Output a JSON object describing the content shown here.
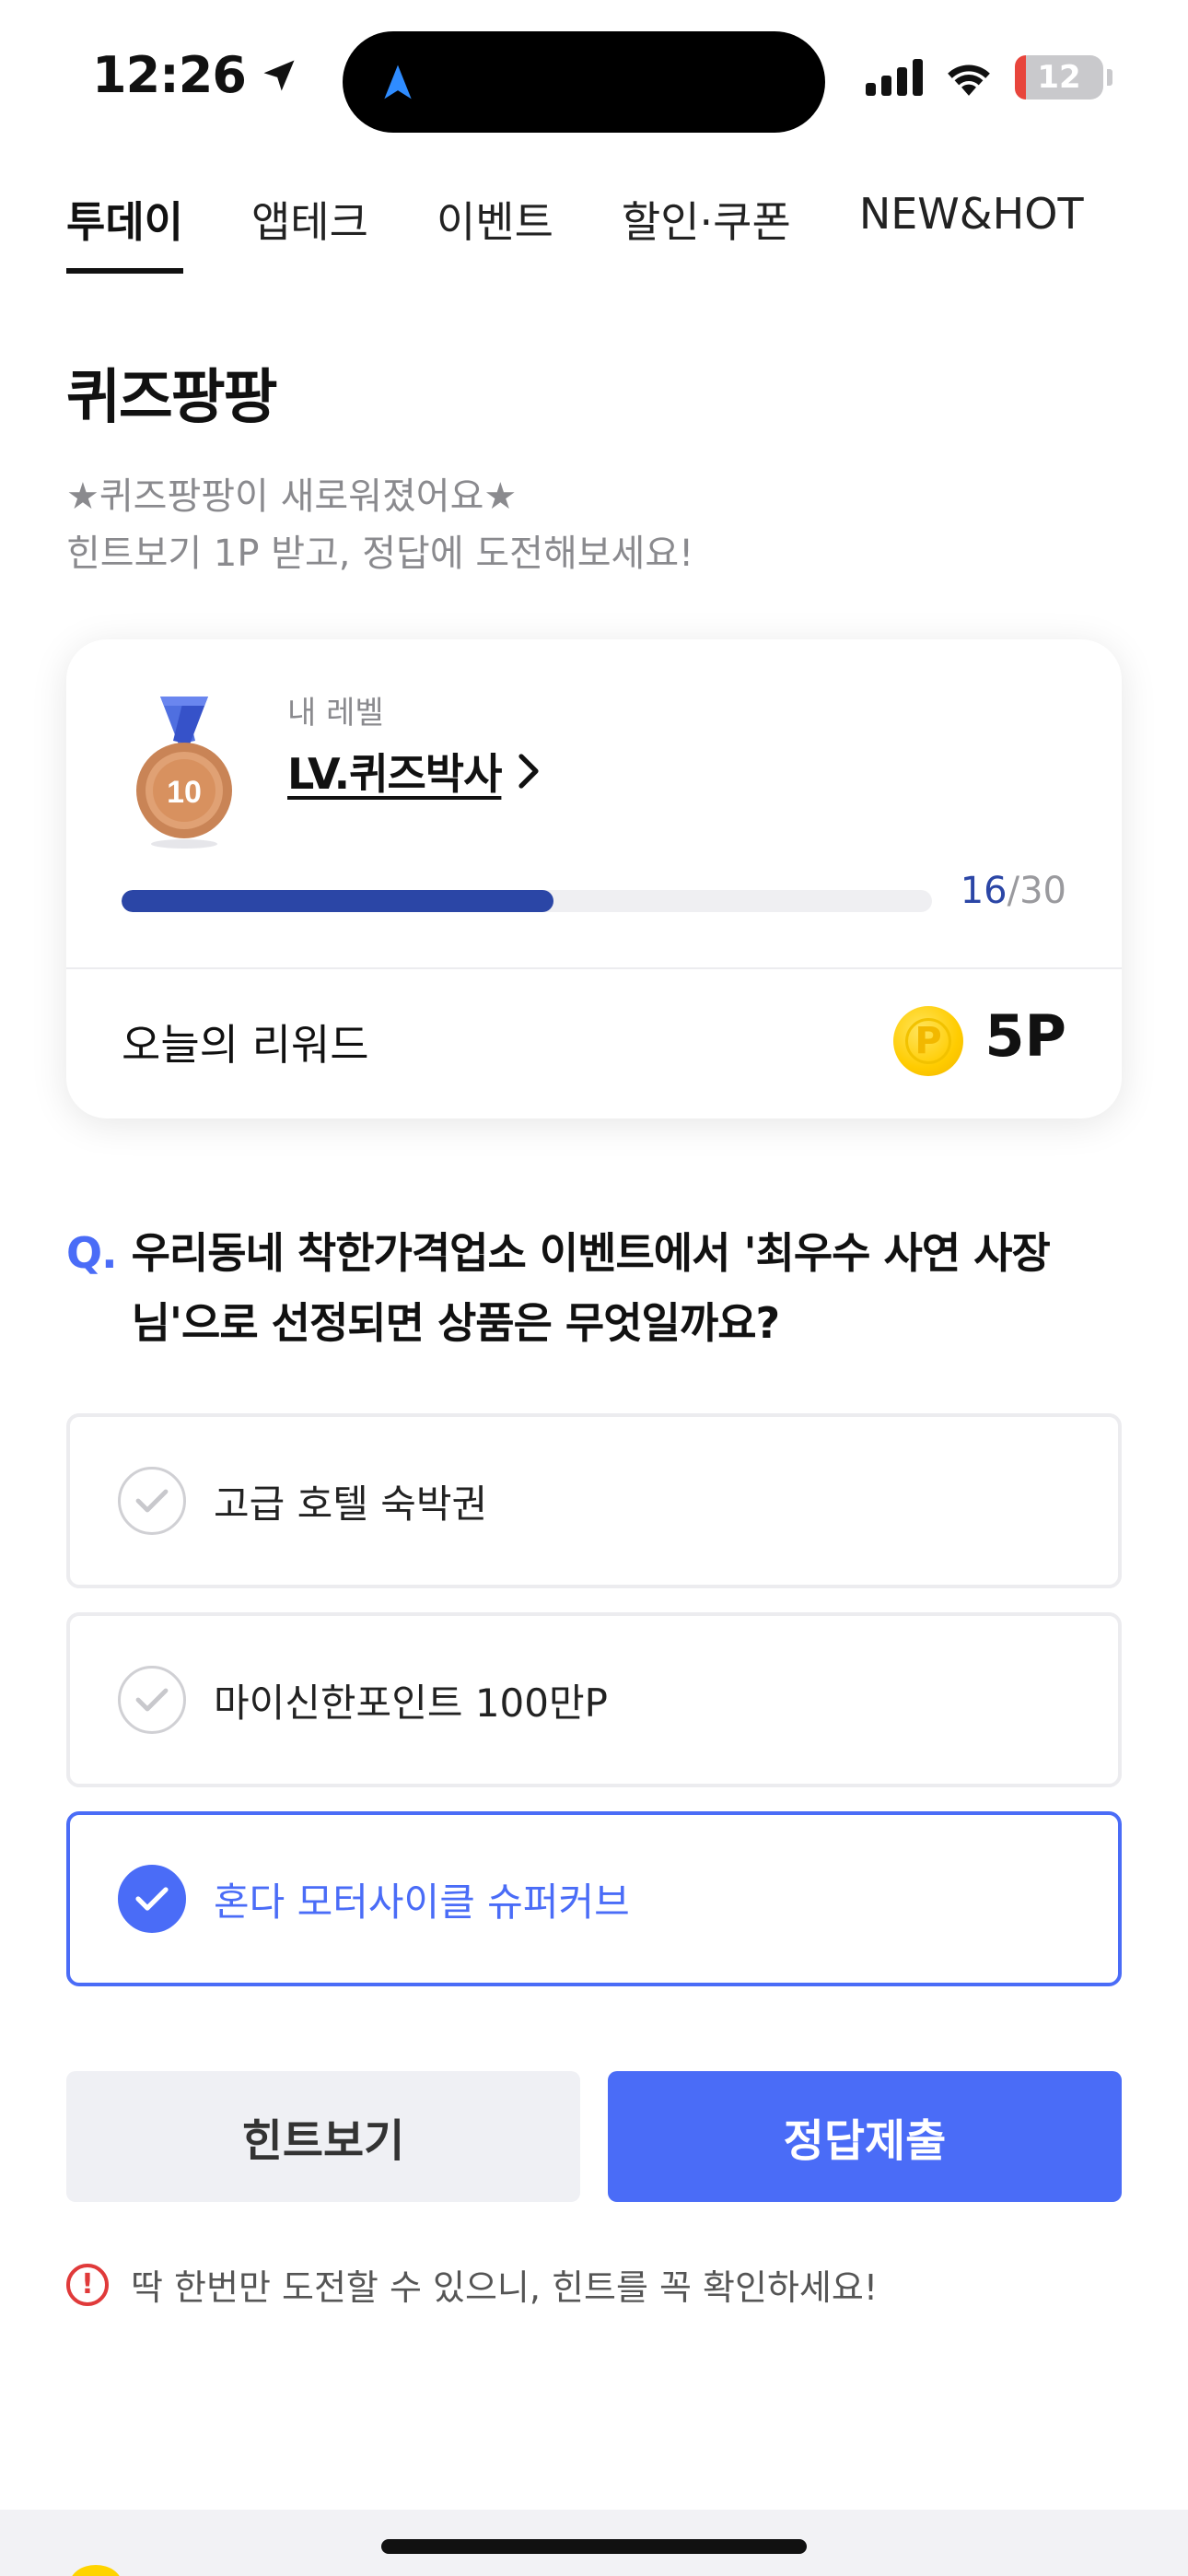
{
  "status": {
    "time": "12:26",
    "battery": "12",
    "battery_level": 0.12
  },
  "tabs": [
    {
      "label": "투데이",
      "active": true
    },
    {
      "label": "앱테크",
      "active": false
    },
    {
      "label": "이벤트",
      "active": false
    },
    {
      "label": "할인·쿠폰",
      "active": false
    },
    {
      "label": "NEW&HOT",
      "active": false
    }
  ],
  "header": {
    "title": "퀴즈팡팡",
    "subtitle_line1": "★퀴즈팡팡이 새로워졌어요★",
    "subtitle_line2": "힌트보기 1P 받고, 정답에 도전해보세요!"
  },
  "level_card": {
    "caption": "내 레벨",
    "level_name": "LV.퀴즈박사",
    "medal_number": "10",
    "progress_current": "16",
    "progress_separator": "/",
    "progress_total": "30",
    "progress_fraction": 0.5333,
    "reward_label": "오늘의 리워드",
    "reward_value": "5P",
    "coin_symbol": "P"
  },
  "quiz": {
    "q_mark": "Q.",
    "question": "우리동네 착한가격업소 이벤트에서 '최우수 사연 사장님'으로 선정되면 상품은 무엇일까요?",
    "options": [
      {
        "label": "고급 호텔 숙박권",
        "selected": false
      },
      {
        "label": "마이신한포인트 100만P",
        "selected": false
      },
      {
        "label": "혼다 모터사이클 슈퍼커브",
        "selected": true
      }
    ]
  },
  "buttons": {
    "hint": "힌트보기",
    "submit": "정답제출"
  },
  "notice": {
    "icon": "!",
    "text": "딱 한번만 도전할 수 있으니, 힌트를 꼭 확인하세요!"
  },
  "colors": {
    "accent": "#4a6cf7",
    "progress": "#2b46a6",
    "warning": "#e03a3a",
    "coin": "#ffcc00"
  }
}
